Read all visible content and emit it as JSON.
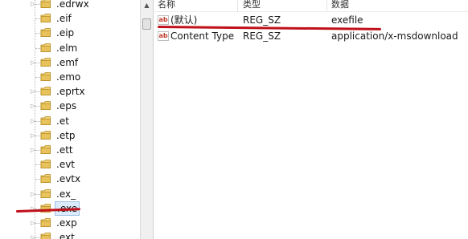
{
  "tree": {
    "items": [
      {
        "label": ".edrwx",
        "expandable": true
      },
      {
        "label": ".eif",
        "expandable": false
      },
      {
        "label": ".eip",
        "expandable": false
      },
      {
        "label": ".elm",
        "expandable": false
      },
      {
        "label": ".emf",
        "expandable": true
      },
      {
        "label": ".emo",
        "expandable": false
      },
      {
        "label": ".eprtx",
        "expandable": true
      },
      {
        "label": ".eps",
        "expandable": true
      },
      {
        "label": ".et",
        "expandable": true
      },
      {
        "label": ".etp",
        "expandable": true
      },
      {
        "label": ".ett",
        "expandable": true
      },
      {
        "label": ".evt",
        "expandable": false
      },
      {
        "label": ".evtx",
        "expandable": false
      },
      {
        "label": ".ex_",
        "expandable": true
      },
      {
        "label": ".exe",
        "expandable": true,
        "selected": true
      },
      {
        "label": ".exp",
        "expandable": true
      },
      {
        "label": ".ext",
        "expandable": true
      }
    ]
  },
  "values": {
    "columns": {
      "name": "名称",
      "type": "类型",
      "data": "数据"
    },
    "rows": [
      {
        "name": "(默认)",
        "type": "REG_SZ",
        "data": "exefile",
        "icon": "string-value-icon"
      },
      {
        "name": "Content Type",
        "type": "REG_SZ",
        "data": "application/x-msdownload",
        "icon": "string-value-icon"
      }
    ]
  },
  "colors": {
    "folder": "#e8c25a",
    "selection": "#dcebfc",
    "annotation": "#c0101a"
  }
}
